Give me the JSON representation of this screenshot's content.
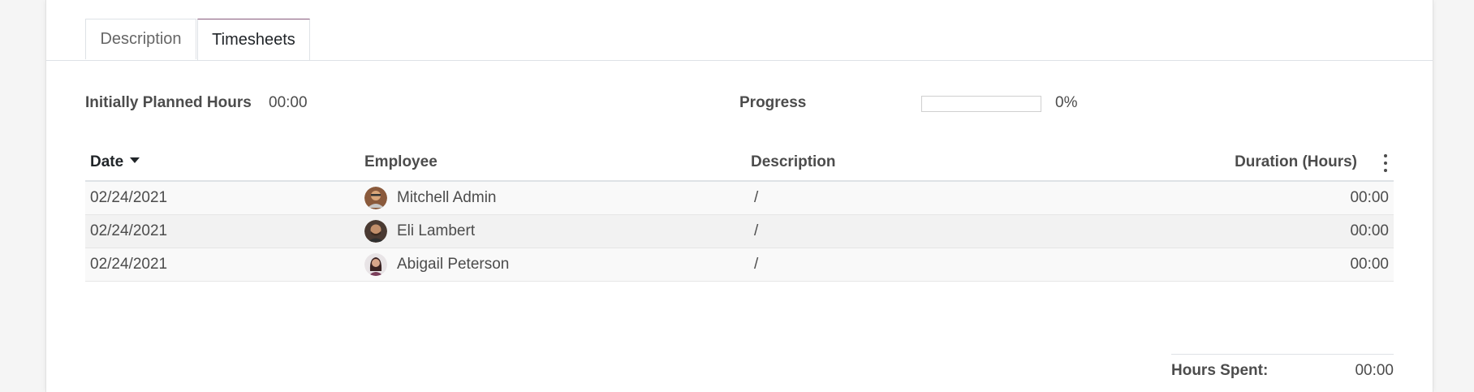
{
  "tabs": [
    {
      "label": "Description",
      "active": false
    },
    {
      "label": "Timesheets",
      "active": true
    }
  ],
  "fields": {
    "planned_hours_label": "Initially Planned Hours",
    "planned_hours_value": "00:00",
    "progress_label": "Progress",
    "progress_value": "0%",
    "progress_fraction": 0
  },
  "table": {
    "columns": {
      "date": "Date",
      "employee": "Employee",
      "description": "Description",
      "duration": "Duration (Hours)"
    },
    "rows": [
      {
        "date": "02/24/2021",
        "employee": "Mitchell Admin",
        "description": "/",
        "duration": "00:00"
      },
      {
        "date": "02/24/2021",
        "employee": "Eli Lambert",
        "description": "/",
        "duration": "00:00"
      },
      {
        "date": "02/24/2021",
        "employee": "Abigail Peterson",
        "description": "/",
        "duration": "00:00"
      }
    ]
  },
  "totals": {
    "hours_spent_label": "Hours Spent:",
    "hours_spent_value": "00:00"
  },
  "colors": {
    "accent": "#875a7b",
    "text": "#4c4c4c"
  },
  "icons": {
    "sort": "caret-down-icon",
    "optional_columns": "kebab-menu-icon"
  }
}
